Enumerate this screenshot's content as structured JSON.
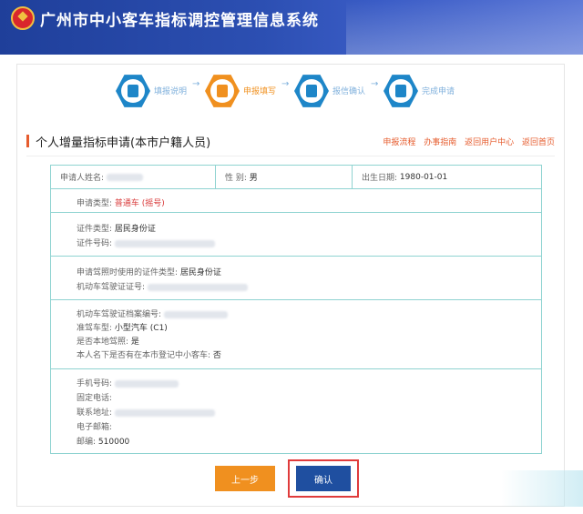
{
  "header": {
    "title": "广州市中小客车指标调控管理信息系统"
  },
  "steps": [
    {
      "label": "填报说明",
      "icon": "document-icon",
      "state": "done"
    },
    {
      "label": "申报填写",
      "icon": "edit-icon",
      "state": "active"
    },
    {
      "label": "报信确认",
      "icon": "phone-icon",
      "state": "todo"
    },
    {
      "label": "完成申请",
      "icon": "check-document-icon",
      "state": "todo"
    }
  ],
  "section": {
    "title": "个人增量指标申请(本市户籍人员)",
    "links": [
      "申报流程",
      "办事指南",
      "返回用户中心",
      "返回首页"
    ]
  },
  "form": {
    "applicant_name_label": "申请人姓名:",
    "gender_label": "性 别:",
    "gender_value": "男",
    "birth_label": "出生日期:",
    "birth_value": "1980-01-01",
    "apply_type_label": "申请类型:",
    "apply_type_value": "普通车 (摇号)",
    "id_type_label": "证件类型:",
    "id_type_value": "居民身份证",
    "id_no_label": "证件号码:",
    "license_id_type_label": "申请驾照时使用的证件类型:",
    "license_id_type_value": "居民身份证",
    "license_no_label": "机动车驾驶证证号:",
    "license_archive_label": "机动车驾驶证档案编号:",
    "vehicle_class_label": "准驾车型:",
    "vehicle_class_value": "小型汽车 (C1)",
    "local_license_label": "是否本地驾照:",
    "local_license_value": "是",
    "registered_car_label": "本人名下是否有在本市登记中小客车:",
    "registered_car_value": "否",
    "phone_label": "手机号码:",
    "landline_label": "固定电话:",
    "address_label": "联系地址:",
    "email_label": "电子邮箱:",
    "postcode_label": "邮编:",
    "postcode_value": "510000"
  },
  "buttons": {
    "prev_label": "上一步",
    "confirm_label": "确认"
  },
  "colors": {
    "header": "#2c4fb2",
    "accent_orange": "#f0901f",
    "table_border": "#8fd3d1",
    "highlight_red": "#e03b3b"
  }
}
